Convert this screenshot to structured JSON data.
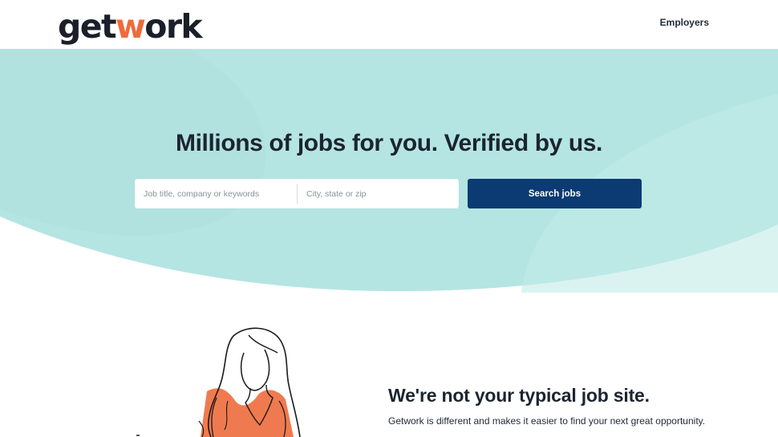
{
  "brand": {
    "logo_prefix": "get",
    "logo_w": "w",
    "logo_suffix": "ork",
    "accent_color": "#ef6a3c",
    "text_color": "#1b1f2a"
  },
  "nav": {
    "employers_label": "Employers"
  },
  "hero": {
    "title": "Millions of jobs for you. Verified by us.",
    "keyword_placeholder": "Job title, company or keywords",
    "location_placeholder": "City, state or zip",
    "search_button_label": "Search jobs",
    "background_color": "#b4e5e2",
    "button_color": "#0c3a72"
  },
  "feature": {
    "heading": "We're not your typical job site.",
    "body": "Getwork is different and makes it easier to find your next great opportunity.",
    "illustration_icon": "woman-line-art-illustration"
  }
}
